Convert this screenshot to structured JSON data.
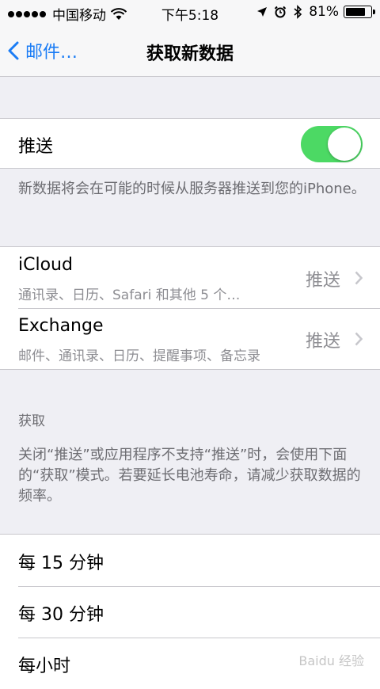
{
  "status_bar": {
    "carrier": "中国移动",
    "time": "下午5:18",
    "battery_percent": "81%",
    "battery_level": 0.81
  },
  "nav": {
    "back_label": "邮件…",
    "title": "获取新数据"
  },
  "push": {
    "label": "推送",
    "enabled": true,
    "description": "新数据将会在可能的时候从服务器推送到您的iPhone。"
  },
  "accounts": [
    {
      "name": "iCloud",
      "detail": "通讯录、日历、Safari 和其他 5 个…",
      "value": "推送"
    },
    {
      "name": "Exchange",
      "detail": "邮件、通讯录、日历、提醒事项、备忘录",
      "value": "推送"
    }
  ],
  "fetch": {
    "header": "获取",
    "description": "关闭“推送”或应用程序不支持“推送”时，会使用下面的“获取”模式。若要延长电池寿命，请减少获取数据的频率。",
    "options": [
      "每 15 分钟",
      "每 30 分钟",
      "每小时"
    ]
  },
  "colors": {
    "accent": "#1a7cf5",
    "toggle_on": "#4cd964",
    "background": "#efeff4"
  },
  "watermark": "Baidu 经验"
}
